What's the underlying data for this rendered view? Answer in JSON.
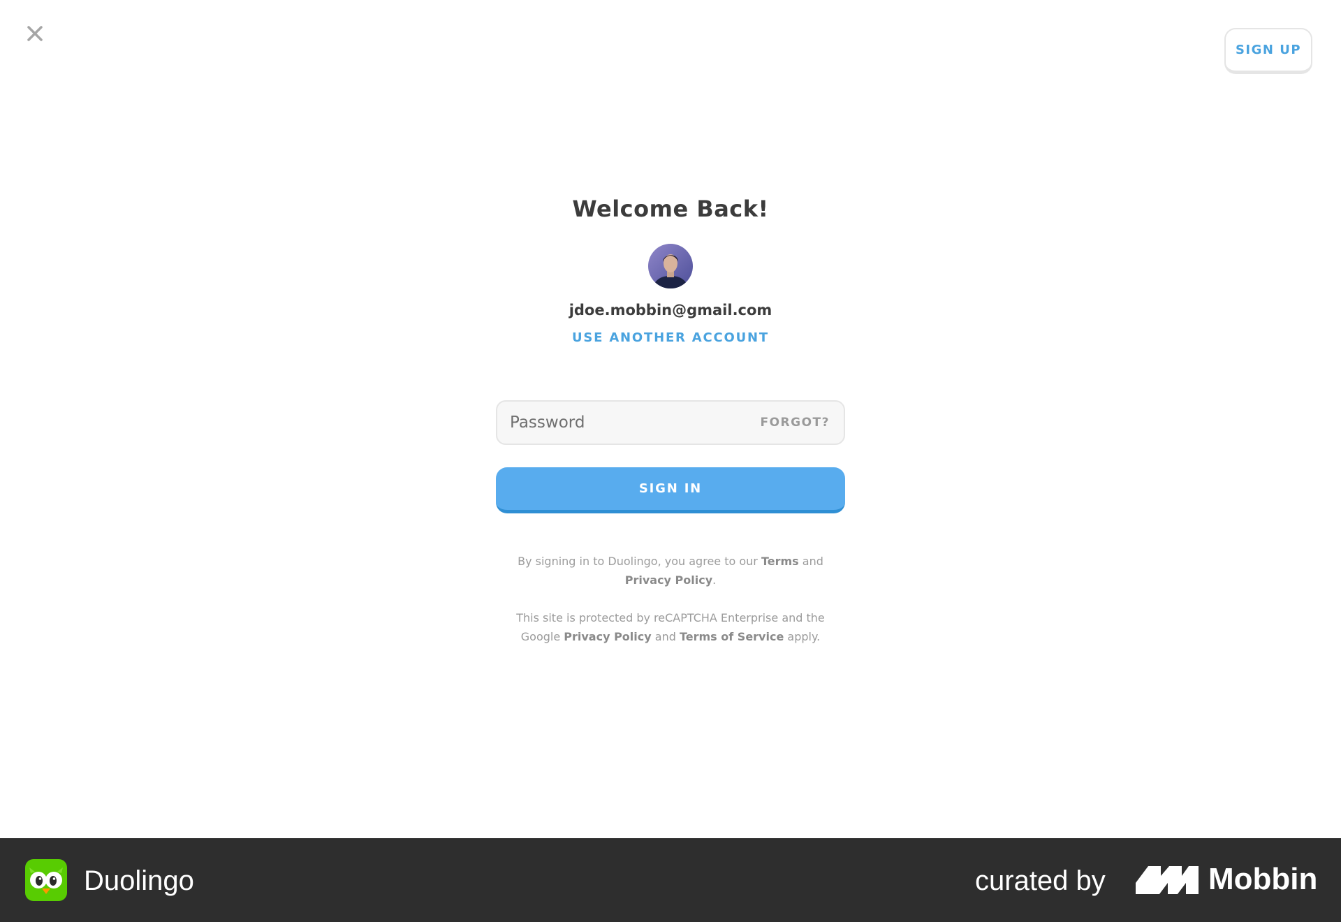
{
  "header": {
    "close_icon": "close-icon",
    "signup_label": "SIGN UP"
  },
  "login": {
    "title": "Welcome Back!",
    "email": "jdoe.mobbin@gmail.com",
    "use_another_label": "USE ANOTHER ACCOUNT",
    "password_placeholder": "Password",
    "password_value": "",
    "forgot_label": "FORGOT?",
    "signin_label": "SIGN IN"
  },
  "legal": {
    "line1_prefix": "By signing in to Duolingo, you agree to our ",
    "terms": "Terms",
    "and1": " and ",
    "privacy": "Privacy Policy",
    "line1_suffix": ".",
    "line2_prefix": "This site is protected by reCAPTCHA Enterprise and the Google ",
    "google_privacy": "Privacy Policy",
    "and2": " and ",
    "terms_of_service": "Terms of Service",
    "line2_suffix": " apply."
  },
  "footer": {
    "app_name": "Duolingo",
    "curated_by": "curated by",
    "brand": "Mobbin"
  },
  "colors": {
    "accent_blue": "#58acee",
    "link_blue": "#4aa3df",
    "footer_bg": "#2e2e2e"
  }
}
